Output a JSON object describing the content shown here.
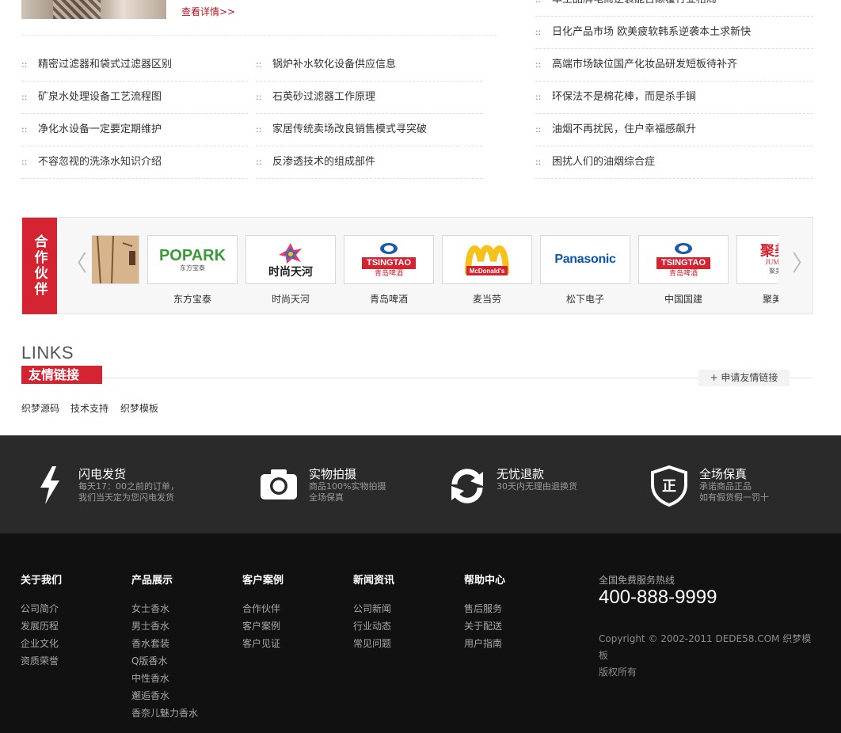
{
  "top": {
    "more_link": "查看详情>>"
  },
  "news_left": [
    "精密过滤器和袋式过滤器区别",
    "矿泉水处理设备工艺流程图",
    "净化水设备一定要定期维护",
    "不容忽视的洗涤水知识介绍"
  ],
  "news_mid": [
    "锅炉补水软化设备供应信息",
    "石英砂过滤器工作原理",
    "家居传统卖场改良销售模式寻突破",
    "反渗透技术的组成部件"
  ],
  "news_right": [
    "本土品牌电商逆袭能否颠覆行业格局",
    "日化产品市场 欧美疲软韩系逆袭本土求新快",
    "高端市场缺位国产化妆品研发短板待补齐",
    "环保法不是棉花棒，而是杀手锏",
    "油烟不再扰民，住户幸福感飙升",
    "困扰人们的油烟综合症"
  ],
  "bullet": "::",
  "partners": {
    "title": "合作伙伴",
    "prev": "〈",
    "next": "〉",
    "items": [
      {
        "name": "",
        "logo": "wood-logo"
      },
      {
        "name": "东方宝泰",
        "logo": "popark-logo",
        "logo_text": "POPARK",
        "logo_sub": "东方宝泰"
      },
      {
        "name": "时尚天河",
        "logo": "star-logo",
        "logo_text": "时尚天河"
      },
      {
        "name": "青岛啤酒",
        "logo": "tsingtao-logo",
        "logo_text": "TSINGTAO",
        "logo_sub": "青岛啤酒"
      },
      {
        "name": "麦当劳",
        "logo": "mcdonalds-logo",
        "logo_text": "McDonald's"
      },
      {
        "name": "松下电子",
        "logo": "panasonic-logo",
        "logo_text": "Panasonic"
      },
      {
        "name": "中国国建",
        "logo": "tsingtao-logo",
        "logo_text": "TSINGTAO",
        "logo_sub": "青岛啤酒"
      },
      {
        "name": "聚美优品",
        "logo": "jumei-logo",
        "logo_text": "聚美优",
        "logo_sub": "JUMEI.CO",
        "logo_sub2": "聚美优品"
      }
    ]
  },
  "links": {
    "title_en": "LINKS",
    "title_cn": "友情链接",
    "apply": "+ 申请友情链接",
    "items": [
      "织梦源码",
      "技术支持",
      "织梦模板"
    ]
  },
  "services": [
    {
      "icon": "lightning-icon",
      "title": "闪电发货",
      "lines": [
        "每天17：00之前的订单，",
        "我们当天定为您闪电发货"
      ]
    },
    {
      "icon": "camera-icon",
      "title": "实物拍摄",
      "lines": [
        "商品100%实物拍摄",
        "全场保真"
      ]
    },
    {
      "icon": "refresh-icon",
      "title": "无忧退款",
      "lines": [
        "30天内无理由退换货"
      ]
    },
    {
      "icon": "shield-icon",
      "icon_text": "正",
      "title": "全场保真",
      "lines": [
        "承诺商品正品",
        "如有假货假一罚十"
      ]
    }
  ],
  "footer": {
    "columns": [
      {
        "title": "关于我们",
        "links": [
          "公司简介",
          "发展历程",
          "企业文化",
          "资质荣誉"
        ]
      },
      {
        "title": "产品展示",
        "links": [
          "女士香水",
          "男士香水",
          "香水套装",
          "Q版香水",
          "中性香水",
          "邂逅香水",
          "香奈儿魅力香水"
        ]
      },
      {
        "title": "客户案例",
        "links": [
          "合作伙伴",
          "客户案例",
          "客户见证"
        ]
      },
      {
        "title": "新闻资讯",
        "links": [
          "公司新闻",
          "行业动态",
          "常见问题"
        ]
      },
      {
        "title": "帮助中心",
        "links": [
          "售后服务",
          "关于配送",
          "用户指南"
        ]
      }
    ],
    "hotline_label": "全国免费服务热线",
    "hotline": "400-888-9999",
    "copyright_1": "Copyright © 2002-2011 DEDE58.COM 织梦模板",
    "copyright_2": "版权所有"
  },
  "colors": {
    "accent": "#d42431",
    "dark": "#2a2a2a",
    "footer": "#111111"
  }
}
